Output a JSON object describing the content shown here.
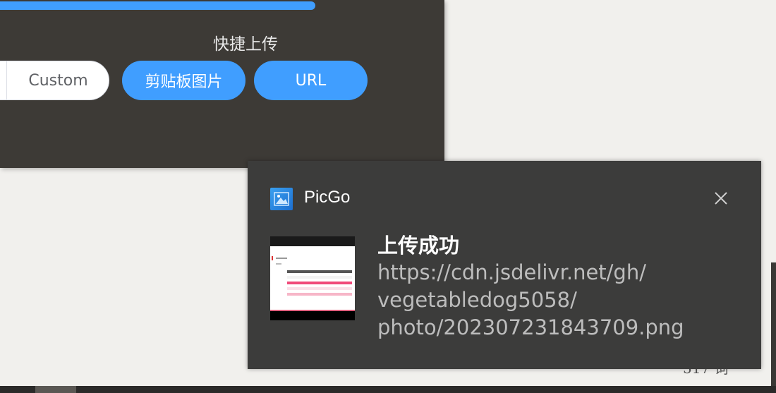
{
  "app_window": {
    "upload_progress_percent": 100,
    "quick_upload_title": "快捷上传",
    "buttons": {
      "custom": "Custom",
      "clipboard": "剪贴板图片",
      "url": "URL"
    }
  },
  "notification": {
    "app_name": "PicGo",
    "title": "上传成功",
    "body_lines": [
      "https://cdn.jsdelivr.net/gh/",
      "vegetabledog5058/",
      "photo/202307231843709.png"
    ]
  },
  "background": {
    "partial_text": "517 词"
  },
  "colors": {
    "accent": "#409eff",
    "window_bg": "#3d3a36",
    "toast_bg": "#3c3c3b",
    "page_bg": "#f1f0ed"
  }
}
